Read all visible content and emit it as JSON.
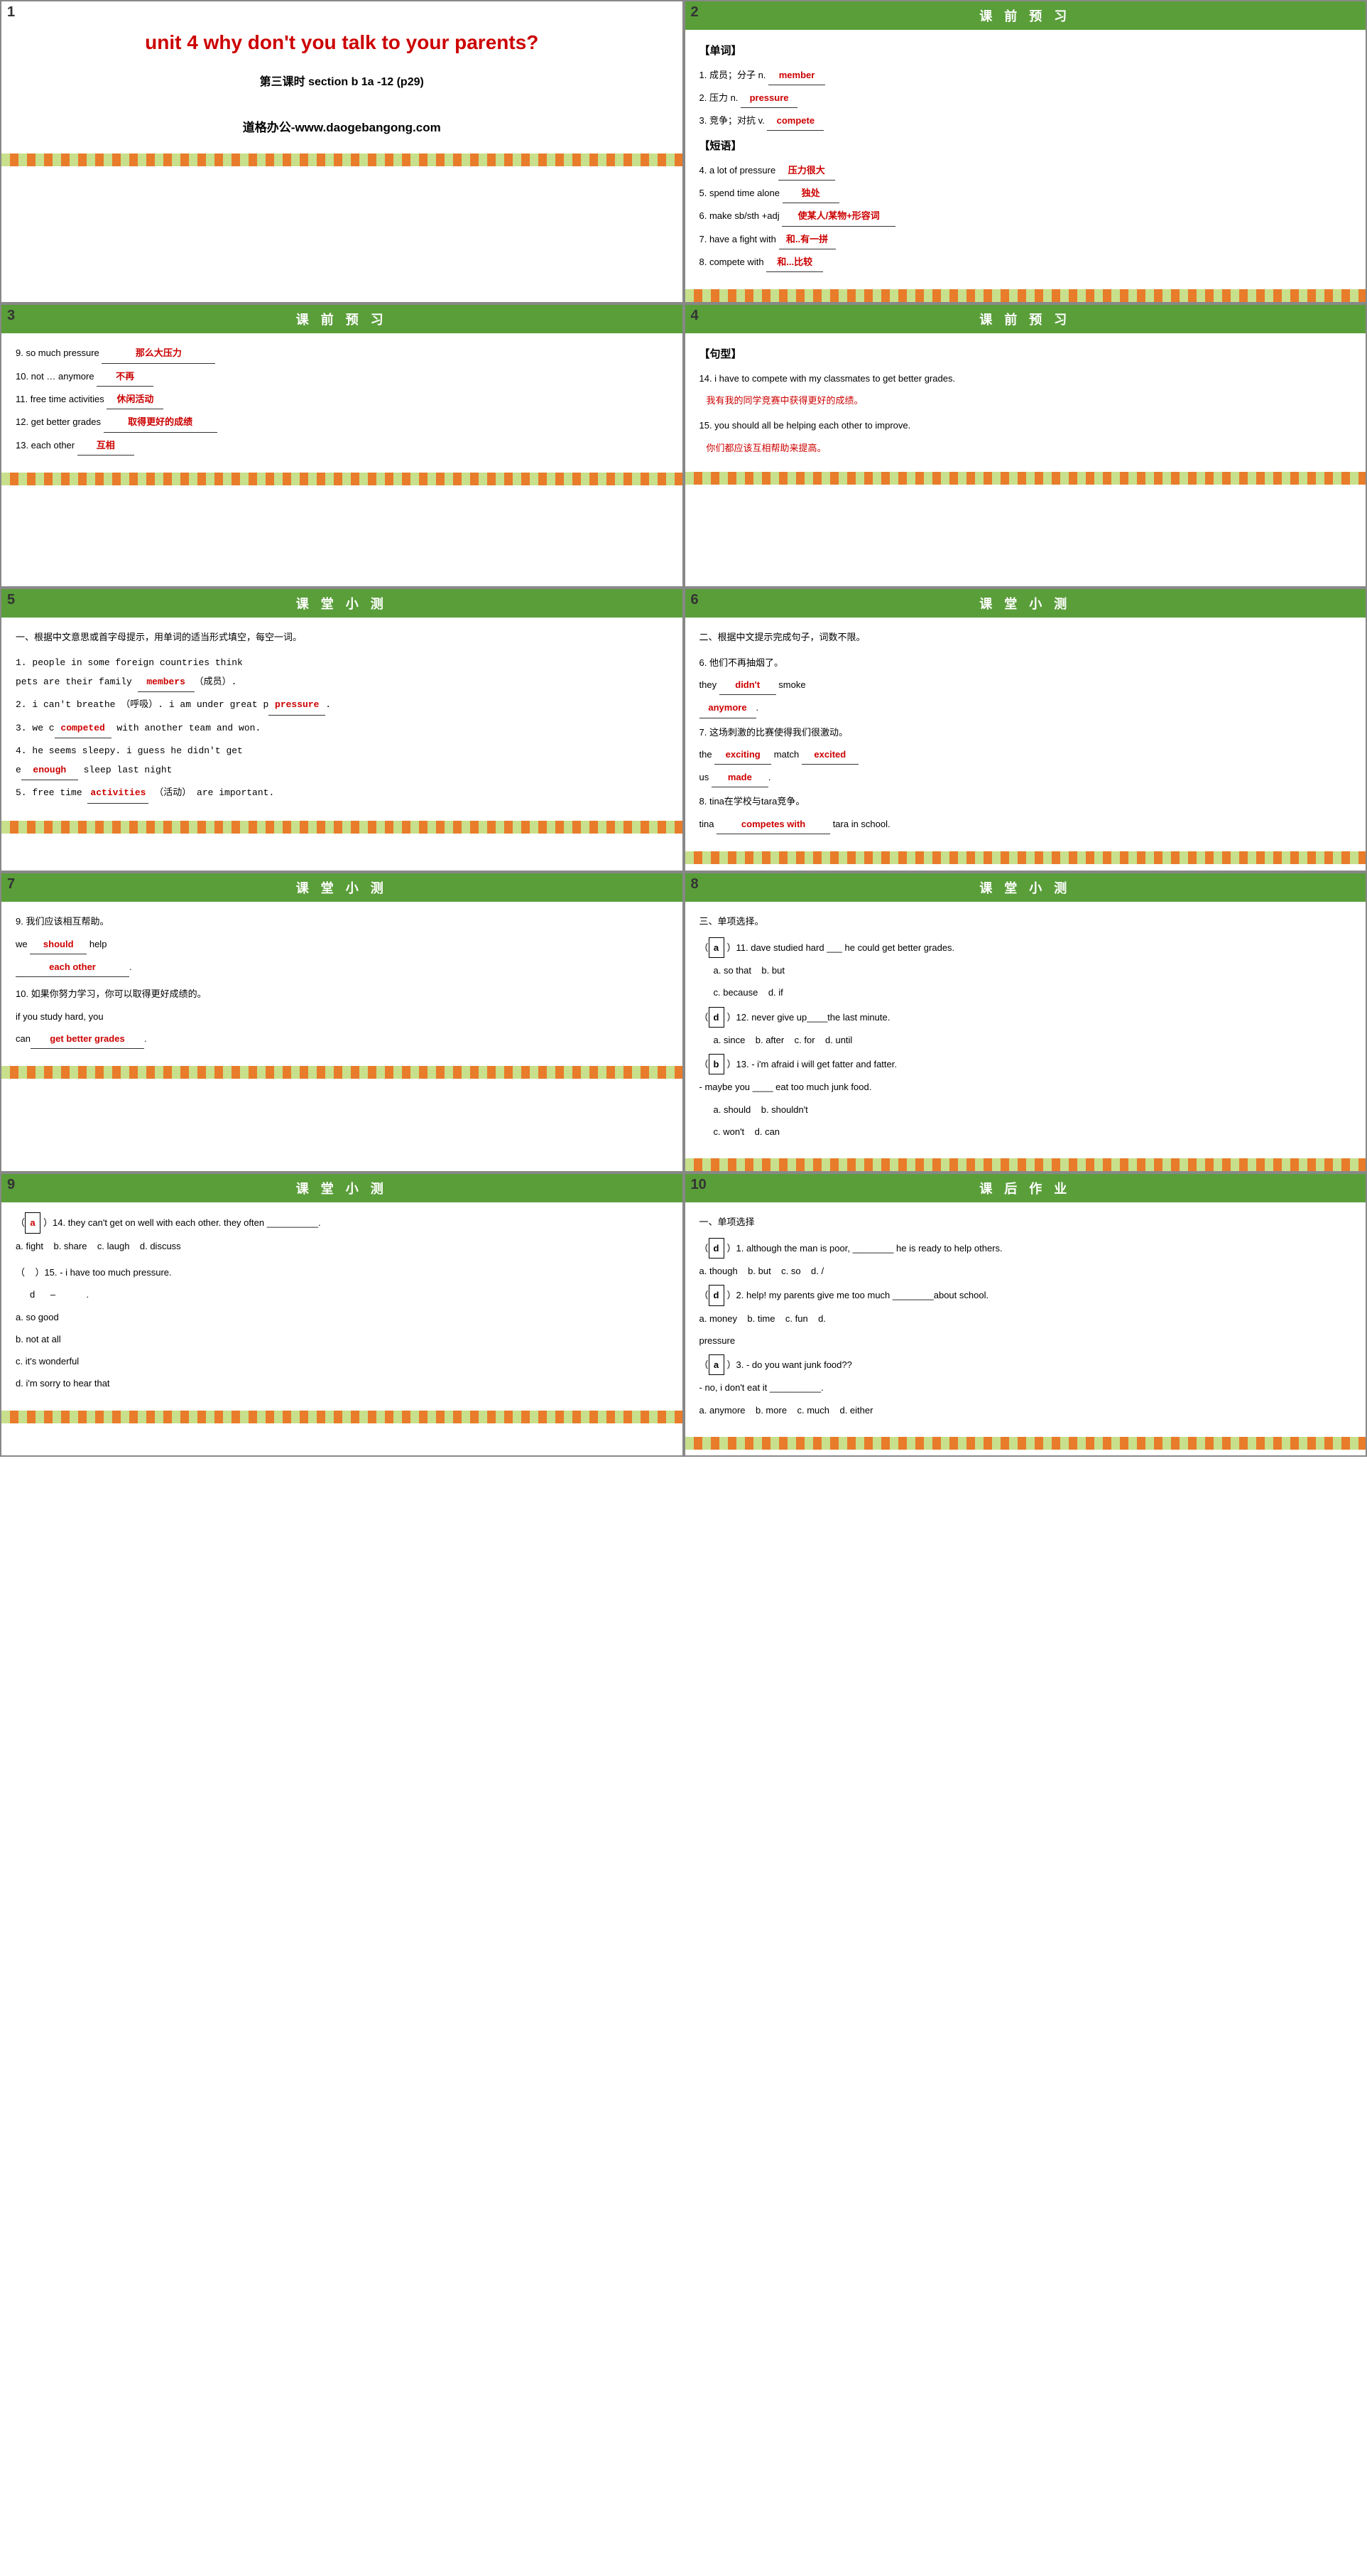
{
  "cells": [
    {
      "id": 1,
      "number": "1",
      "type": "title",
      "title": "unit 4  why don't you talk to your parents?",
      "subtitle": "第三课时  section b 1a -12 (p29)",
      "website": "道格办公-www.daogebangong.com"
    },
    {
      "id": 2,
      "number": "2",
      "header": "课 前 预 习",
      "type": "vocab",
      "content": [
        {
          "label": "【单词】",
          "bold": true
        },
        {
          "text": "1. 成员；分子 n.",
          "fill": "member",
          "fill_type": "red"
        },
        {
          "text": "2. 压力 n.",
          "fill": "pressure",
          "fill_type": "red"
        },
        {
          "text": "3. 竞争；对抗 v.",
          "fill": "compete",
          "fill_type": "red"
        },
        {
          "label": "【短语】",
          "bold": true
        },
        {
          "text": "4. a lot of pressure",
          "fill": "压力很大",
          "fill_type": "red"
        },
        {
          "text": "5. spend time alone",
          "fill": "独处",
          "fill_type": "red"
        },
        {
          "text": "6. make sb/sth +adj",
          "fill": "使某人/某物+形容词",
          "fill_type": "red"
        },
        {
          "text": "7. have a fight with",
          "fill": "和..有一拼",
          "fill_type": "red"
        },
        {
          "text": "8. compete with",
          "fill": "和...比较",
          "fill_type": "red"
        }
      ]
    },
    {
      "id": 3,
      "number": "3",
      "header": "课 前 预 习",
      "type": "vocab2",
      "content": [
        {
          "text": "9. so much pressure",
          "fill": "那么大压力",
          "fill_type": "red"
        },
        {
          "text": "10. not … anymore",
          "fill": "不再",
          "fill_type": "red"
        },
        {
          "text": "11. free time activities",
          "fill": "休闲活动",
          "fill_type": "red"
        },
        {
          "text": "12. get better grades",
          "fill": "取得更好的成绩",
          "fill_type": "red"
        },
        {
          "text": "13. each other",
          "fill": "互相",
          "fill_type": "red"
        }
      ]
    },
    {
      "id": 4,
      "number": "4",
      "header": "课 前 预 习",
      "type": "sentences",
      "label": "【句型】",
      "items": [
        {
          "en": "14. i have to compete with my classmates to get better grades.",
          "zh": "我有我的同学竞赛中获得更好的成绩。"
        },
        {
          "en": "15. you should all be helping each other to improve.",
          "zh": "你们都应该互相帮助来提高。"
        }
      ]
    },
    {
      "id": 5,
      "number": "5",
      "header": "课 堂 小 测",
      "type": "exercise1",
      "instruction": "一、根据中文意思或首字母提示，用单词的适当形式填空，每空一词。",
      "items": [
        {
          "text": "1. people in some foreign countries think pets are their family",
          "fill": "members",
          "fill_type": "red",
          "suffix": "（成员）."
        },
        {
          "text": "2. i can't breathe （呼吸）. i am under great p",
          "fill": "pressure",
          "fill_type": "red",
          "suffix": "."
        },
        {
          "text": "3. we c",
          "fill": "competed",
          "fill_type": "red",
          "suffix": " with another team and won."
        },
        {
          "text": "4. he seems sleepy. i guess he didn't get e",
          "fill": "enough",
          "fill_type": "red",
          "suffix": " sleep last night"
        },
        {
          "text": "5. free time",
          "fill": "activities",
          "fill_type": "red",
          "suffix": " （活动） are important."
        }
      ]
    },
    {
      "id": 6,
      "number": "6",
      "header": "课 堂 小 测",
      "type": "exercise2",
      "instruction": "二、根据中文提示完成句子，词数不限。",
      "items": [
        {
          "zh": "6. 他们不再抽烟了。",
          "en_pre": "they",
          "fill1": "didn't",
          "fill1_type": "red",
          "en_mid": "smoke",
          "fill2": "anymore",
          "fill2_type": "red",
          "en_suf": "."
        },
        {
          "zh": "7. 这场刺激的比赛使得我们很激动。",
          "en_pre": "the",
          "fill1": "exciting",
          "fill1_type": "red",
          "en_mid": "match",
          "fill2": "excited",
          "fill2_type": "red",
          "en_suf": "us",
          "fill3": "made",
          "fill3_type": "red",
          "en_suf2": "."
        },
        {
          "zh": "8. tina在学校与tara竞争。",
          "en_pre": "tina",
          "fill1": "competes with",
          "fill1_type": "red",
          "en_mid": "tara in school."
        }
      ]
    },
    {
      "id": 7,
      "number": "7",
      "header": "课 堂 小 测",
      "type": "exercise3",
      "items": [
        {
          "zh": "9. 我们应该相互帮助。",
          "en_pre": "we",
          "fill1": "should",
          "fill1_type": "red",
          "en_mid": "help",
          "fill2": "each other",
          "fill2_type": "red",
          "en_suf": "."
        },
        {
          "zh": "10. 如果你努力学习，你可以取得更好成绩的。",
          "en_pre": "if you study hard, you can",
          "fill1": "get better grades",
          "fill1_type": "red",
          "en_suf": "."
        }
      ]
    },
    {
      "id": 8,
      "number": "8",
      "header": "课 堂 小 测",
      "type": "mcq1",
      "instruction": "三、单项选择。",
      "items": [
        {
          "answer": "a",
          "num": "11",
          "text": "dave studied hard ___ he could get better grades.",
          "options": [
            "a. so that",
            "b. but",
            "c. because",
            "d. if"
          ]
        },
        {
          "answer": "d",
          "num": "12",
          "text": "never give up____the last minute.",
          "options": [
            "a. since",
            "b. after",
            "c. for",
            "d. until"
          ]
        },
        {
          "answer": "b",
          "num": "13",
          "text": "- i'm afraid i will get fatter and fatter.\n- maybe you ____ eat too much junk food.",
          "options": [
            "a. should",
            "b. shouldn't",
            "c. won't",
            "d. can"
          ]
        }
      ]
    },
    {
      "id": 9,
      "number": "9",
      "header": "课 堂 小 测",
      "type": "mcq2",
      "items": [
        {
          "answer": "a",
          "num": "14",
          "text": "they can't get on well with each other. they often __________.",
          "options": [
            "a. fight",
            "b. share",
            "c. laugh",
            "d. discuss"
          ]
        },
        {
          "num": "15",
          "text": "- i have too much pressure.\n- d          –          .",
          "sub_options": [
            "a. so good",
            "b. not at all",
            "c. it's wonderful",
            "d. i'm sorry to hear that"
          ]
        }
      ]
    },
    {
      "id": 10,
      "number": "10",
      "header": "课 后 作 业",
      "type": "homework",
      "instruction": "一、单项选择",
      "items": [
        {
          "answer": "d",
          "num": "1",
          "text": "although the man is poor, ________ he is ready to help others.",
          "options": [
            "a. though",
            "b. but",
            "c. so",
            "d. /"
          ]
        },
        {
          "answer": "d",
          "num": "2",
          "text": "help! my parents give me too much ________about school.",
          "options": [
            "a. money",
            "b. time",
            "c. fun",
            "d. pressure"
          ]
        },
        {
          "answer": "a",
          "num": "3",
          "text": "- do you want junk food??\n- no, i don't eat it __________.",
          "options": [
            "a. anymore",
            "b. more",
            "c. much",
            "d. either"
          ]
        }
      ]
    }
  ]
}
